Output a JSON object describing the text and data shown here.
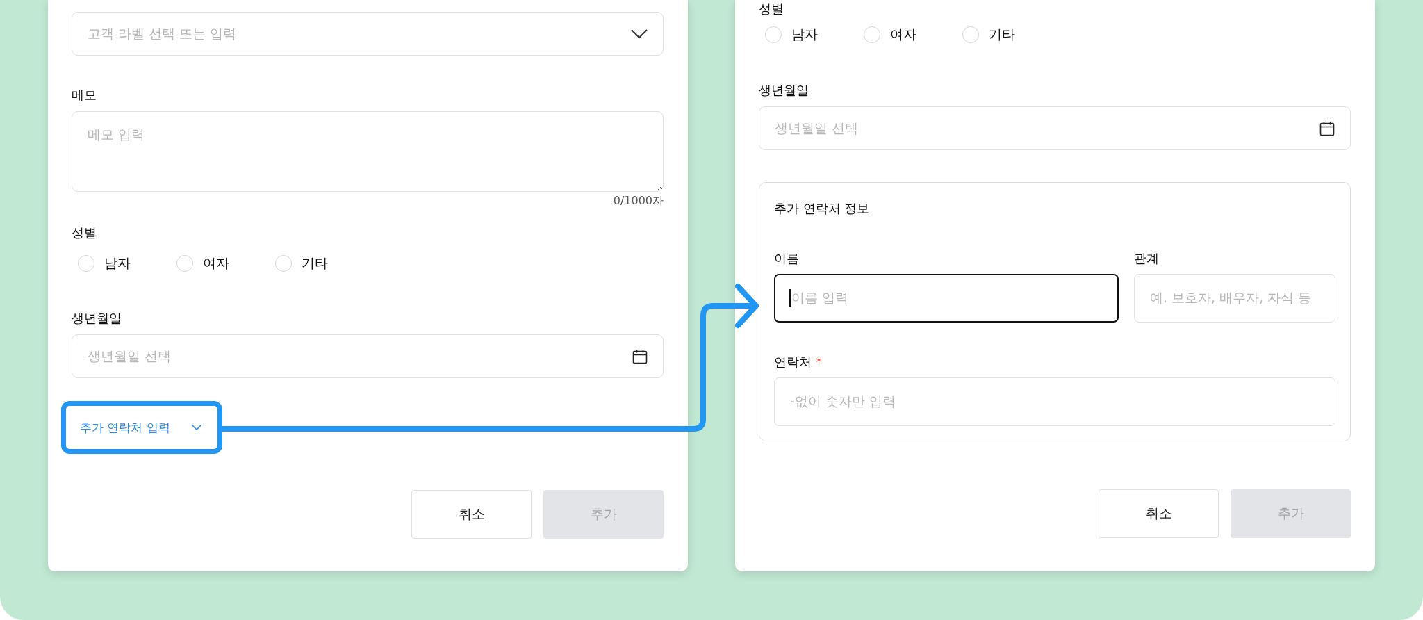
{
  "left_panel": {
    "label_select": {
      "placeholder": "고객 라벨 선택 또는 입력"
    },
    "memo": {
      "label": "메모",
      "placeholder": "메모 입력",
      "counter": "0/1000자"
    },
    "gender": {
      "label": "성별",
      "options": [
        {
          "label": "남자",
          "selected": false
        },
        {
          "label": "여자",
          "selected": false
        },
        {
          "label": "기타",
          "selected": false
        }
      ]
    },
    "birthdate": {
      "label": "생년월일",
      "placeholder": "생년월일 선택"
    },
    "toggle": {
      "label": "추가 연락처 입력",
      "expanded": false
    },
    "buttons": [
      {
        "label": "취소",
        "kind": "secondary",
        "disabled": false
      },
      {
        "label": "추가",
        "kind": "primary",
        "disabled": true
      }
    ]
  },
  "right_panel": {
    "gender": {
      "label": "성별",
      "options": [
        {
          "label": "남자",
          "selected": false
        },
        {
          "label": "여자",
          "selected": false
        },
        {
          "label": "기타",
          "selected": false
        }
      ]
    },
    "birthdate": {
      "label": "생년월일",
      "placeholder": "생년월일 선택"
    },
    "extra_contact": {
      "title": "추가 연락처 정보",
      "fields": [
        {
          "label": "이름",
          "placeholder": "이름 입력",
          "focused": true
        },
        {
          "label": "관계",
          "placeholder": "예. 보호자, 배우자, 자식 등",
          "focused": false
        },
        {
          "label": "연락처",
          "required_mark": "*",
          "placeholder": "-없이 숫자만 입력",
          "focused": false
        }
      ]
    },
    "buttons": [
      {
        "label": "취소",
        "kind": "secondary",
        "disabled": false
      },
      {
        "label": "추가",
        "kind": "primary",
        "disabled": true
      }
    ]
  }
}
